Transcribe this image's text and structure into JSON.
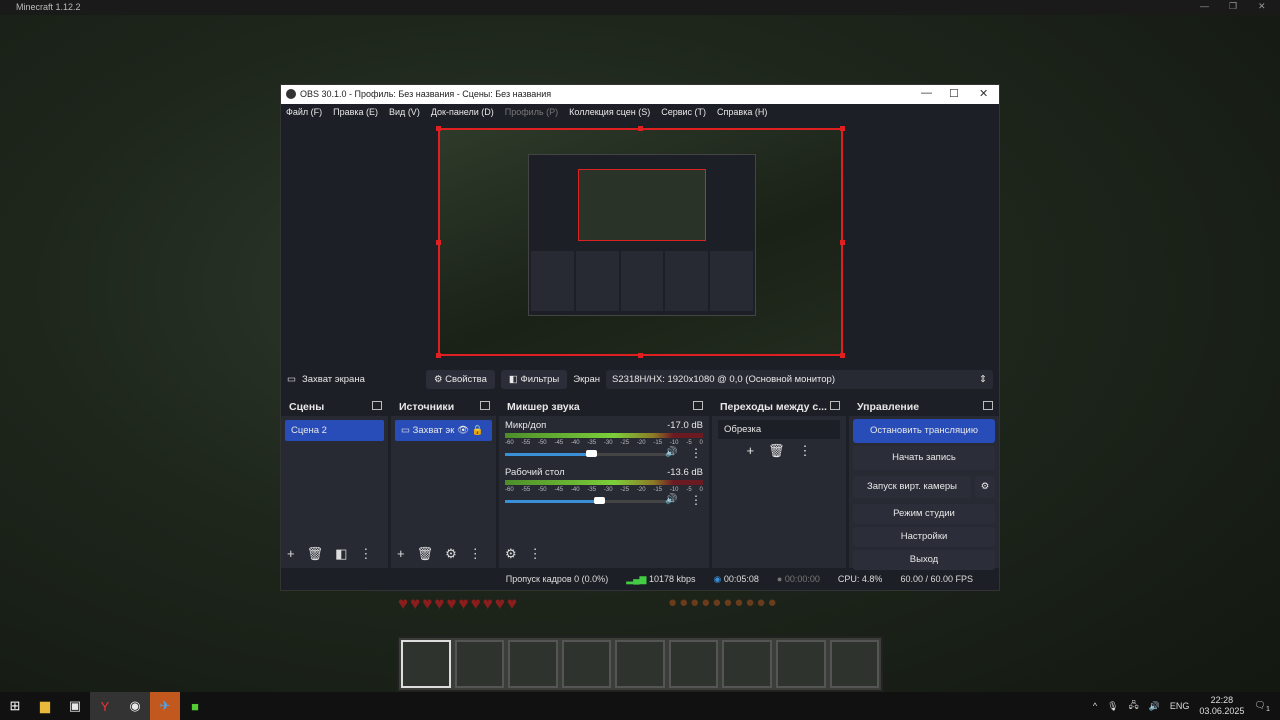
{
  "minecraft": {
    "title": "Minecraft 1.12.2"
  },
  "obs": {
    "title": "OBS 30.1.0 - Профиль: Без названия - Сцены: Без названия",
    "menu": [
      "Файл (F)",
      "Правка (E)",
      "Вид (V)",
      "Док-панели (D)",
      "Профиль (P)",
      "Коллекция сцен (S)",
      "Сервис (T)",
      "Справка (H)"
    ],
    "source_bar": {
      "source_name": "Захват экрана",
      "properties": "Свойства",
      "filters": "Фильтры",
      "display_label": "Экран",
      "display_value": "S2318H/HX: 1920x1080 @ 0,0 (Основной монитор)"
    },
    "scenes": {
      "title": "Сцены",
      "items": [
        "Сцена 2"
      ]
    },
    "sources": {
      "title": "Источники",
      "items": [
        "Захват эк"
      ]
    },
    "mixer": {
      "title": "Микшер звука",
      "scale": [
        "-60",
        "-55",
        "-50",
        "-45",
        "-40",
        "-35",
        "-30",
        "-25",
        "-20",
        "-15",
        "-10",
        "-5",
        "0"
      ],
      "channels": [
        {
          "name": "Микр/доп",
          "db": "-17.0 dB",
          "volume": 0.52
        },
        {
          "name": "Рабочий стол",
          "db": "-13.6 dB",
          "volume": 0.57
        }
      ]
    },
    "transitions": {
      "title": "Переходы между с...",
      "selected": "Обрезка"
    },
    "controls": {
      "title": "Управление",
      "buttons": [
        "Остановить трансляцию",
        "Начать запись",
        "Запуск вирт. камеры",
        "Режим студии",
        "Настройки",
        "Выход"
      ]
    },
    "status": {
      "dropped": "Пропуск кадров 0 (0.0%)",
      "bitrate": "10178 kbps",
      "stream_time": "00:05:08",
      "record_time": "00:00:00",
      "cpu": "CPU: 4.8%",
      "fps": "60.00 / 60.00 FPS"
    }
  },
  "taskbar": {
    "lang": "ENG",
    "time": "22:28",
    "date": "03.06.2025",
    "notifications": "1"
  }
}
